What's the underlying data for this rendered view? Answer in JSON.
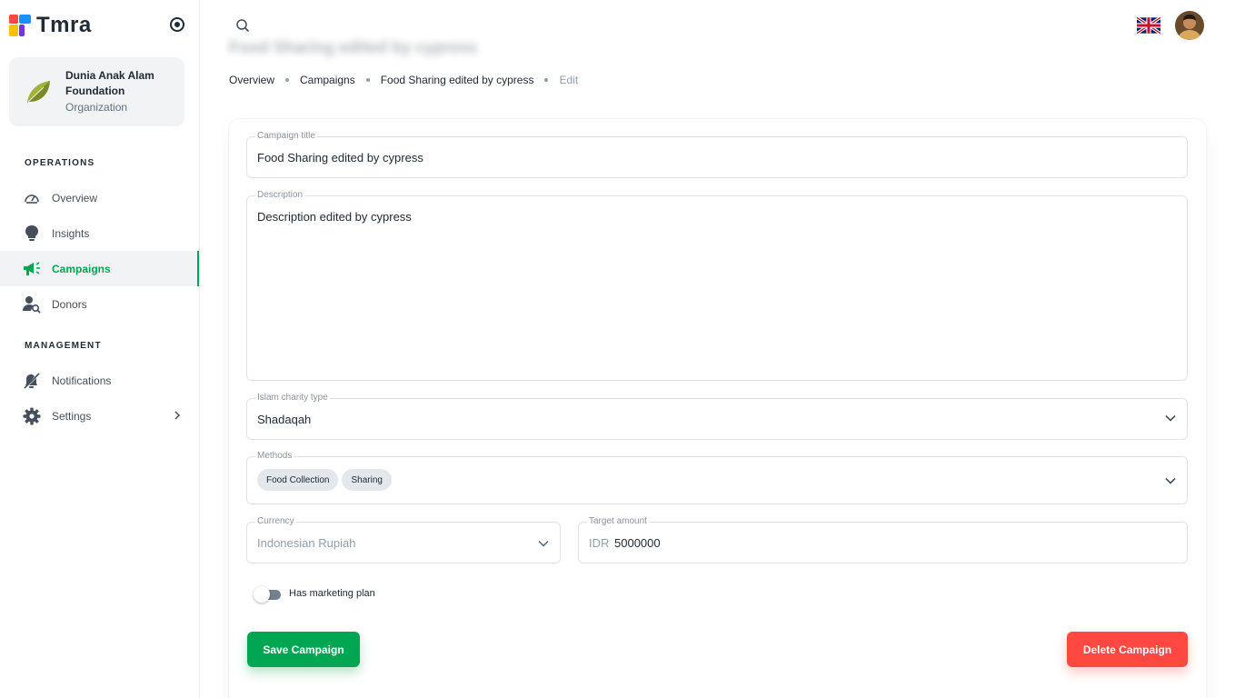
{
  "app": {
    "name": "Tmra"
  },
  "org": {
    "name": "Dunia Anak Alam Foundation",
    "role": "Organization"
  },
  "sidebar": {
    "section_operations": "OPERATIONS",
    "section_management": "MANAGEMENT",
    "items": [
      {
        "label": "Overview",
        "icon": "speedometer-icon"
      },
      {
        "label": "Insights",
        "icon": "lightbulb-icon"
      },
      {
        "label": "Campaigns",
        "icon": "megaphone-icon",
        "active": true
      },
      {
        "label": "Donors",
        "icon": "user-search-icon"
      },
      {
        "label": "Notifications",
        "icon": "bell-icon"
      },
      {
        "label": "Settings",
        "icon": "gear-icon"
      }
    ]
  },
  "header": {
    "page_title": "Food Sharing edited by cypress",
    "breadcrumb": [
      "Overview",
      "Campaigns",
      "Food Sharing edited by cypress",
      "Edit"
    ]
  },
  "form": {
    "title_label": "Campaign title",
    "title_value": "Food Sharing edited by cypress",
    "description_label": "Description",
    "description_value": "Description edited by cypress",
    "charity_label": "Islam charity type",
    "charity_value": "Shadaqah",
    "methods_label": "Methods",
    "methods": [
      "Food Collection",
      "Sharing"
    ],
    "currency_label": "Currency",
    "currency_value": "Indonesian Rupiah",
    "target_label": "Target amount",
    "target_prefix": "IDR",
    "target_value": "5000000",
    "marketing_label": "Has marketing plan",
    "save_label": "Save Campaign",
    "delete_label": "Delete Campaign"
  },
  "colors": {
    "primary": "#00a651",
    "danger": "#ff4842",
    "text": "#212b36",
    "muted": "#919eab"
  }
}
